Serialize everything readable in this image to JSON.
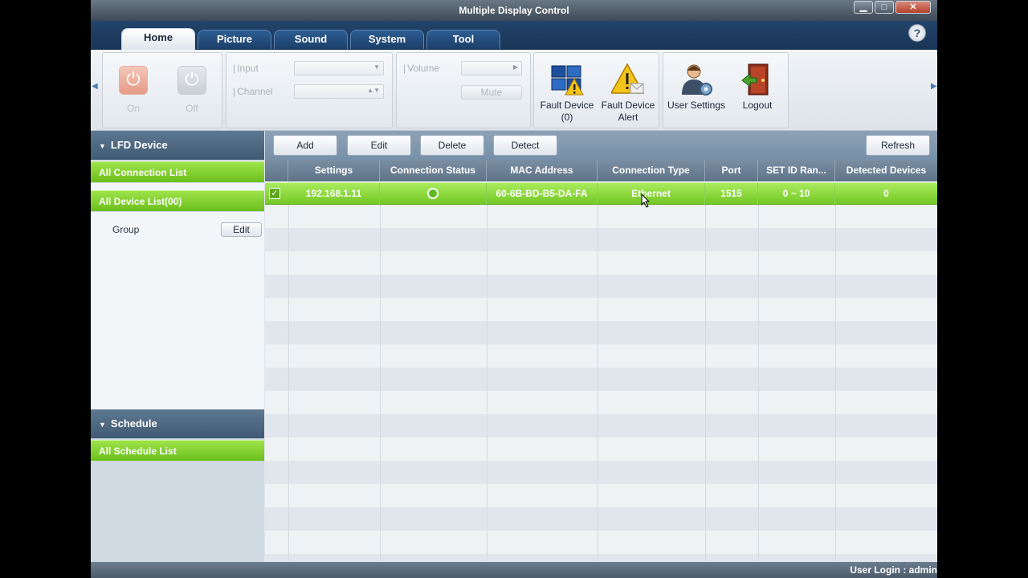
{
  "window": {
    "title": "Multiple Display Control",
    "min": "▁",
    "max": "□",
    "close": "✕"
  },
  "tabs": [
    "Home",
    "Picture",
    "Sound",
    "System",
    "Tool"
  ],
  "help": "?",
  "ribbon": {
    "on_label": "On",
    "off_label": "Off",
    "input_label": "Input",
    "channel_label": "Channel",
    "volume_label": "Volume",
    "mute_label": "Mute",
    "fault_device_label": "Fault Device\n(0)",
    "fault_device_line1": "Fault Device",
    "fault_device_line2": "(0)",
    "fault_alert_line1": "Fault Device",
    "fault_alert_line2": "Alert",
    "user_settings_label": "User Settings",
    "logout_label": "Logout"
  },
  "left": {
    "lfd_header": "LFD Device",
    "all_connection": "All Connection List",
    "all_device": "All Device List(00)",
    "group_label": "Group",
    "group_edit": "Edit",
    "schedule_header": "Schedule",
    "all_schedule": "All Schedule List"
  },
  "toolbar": {
    "add": "Add",
    "edit": "Edit",
    "delete": "Delete",
    "detect": "Detect",
    "refresh": "Refresh"
  },
  "table": {
    "columns": [
      "Settings",
      "Connection Status",
      "MAC Address",
      "Connection Type",
      "Port",
      "SET ID Ran...",
      "Detected Devices"
    ],
    "rows": [
      {
        "settings": "192.168.1.11",
        "status": "connected",
        "mac": "60-6B-BD-B5-DA-FA",
        "type": "Ethernet",
        "port": "1515",
        "setid": "0 ~ 10",
        "detected": "0"
      }
    ]
  },
  "status": {
    "user_login": "User Login : admin"
  },
  "colors": {
    "accent_green": "#74c725",
    "header_blue": "#405a73",
    "tabbar": "#1a3556"
  }
}
